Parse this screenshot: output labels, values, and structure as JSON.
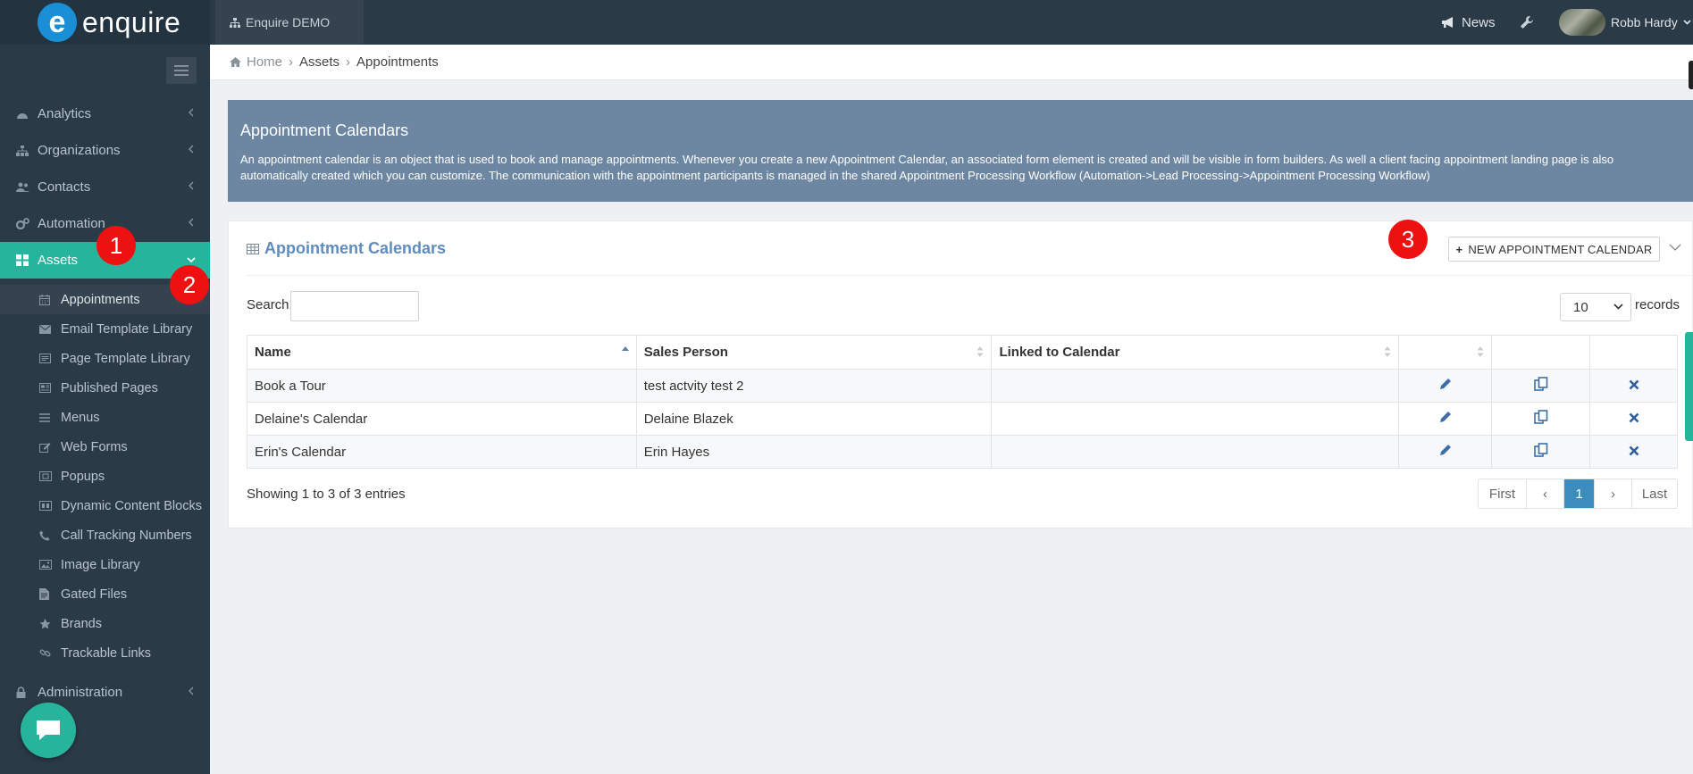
{
  "app": {
    "logo_letter": "e",
    "logo_text": "enquire",
    "account": "Enquire DEMO"
  },
  "header": {
    "news_label": "News",
    "user_name": "Robb Hardy"
  },
  "sidebar": {
    "items": [
      {
        "label": "Analytics",
        "icon": "dashboard-icon"
      },
      {
        "label": "Organizations",
        "icon": "sitemap-icon"
      },
      {
        "label": "Contacts",
        "icon": "users-icon"
      },
      {
        "label": "Automation",
        "icon": "cogs-icon"
      },
      {
        "label": "Assets",
        "icon": "grid-icon",
        "active": true
      },
      {
        "label": "Administration",
        "icon": "lock-icon"
      }
    ],
    "sub_items": [
      {
        "label": "Appointments",
        "icon": "calendar-icon",
        "current": true
      },
      {
        "label": "Email Template Library",
        "icon": "envelope-icon"
      },
      {
        "label": "Page Template Library",
        "icon": "page-template-icon"
      },
      {
        "label": "Published Pages",
        "icon": "published-page-icon"
      },
      {
        "label": "Menus",
        "icon": "menu-lines-icon"
      },
      {
        "label": "Web Forms",
        "icon": "edit-icon"
      },
      {
        "label": "Popups",
        "icon": "popup-icon"
      },
      {
        "label": "Dynamic Content Blocks",
        "icon": "blocks-icon"
      },
      {
        "label": "Call Tracking Numbers",
        "icon": "phone-icon"
      },
      {
        "label": "Image Library",
        "icon": "image-icon"
      },
      {
        "label": "Gated Files",
        "icon": "file-icon"
      },
      {
        "label": "Brands",
        "icon": "star-icon"
      },
      {
        "label": "Trackable Links",
        "icon": "link-icon"
      }
    ]
  },
  "markers": [
    "1",
    "2",
    "3"
  ],
  "breadcrumb": [
    "Home",
    "Assets",
    "Appointments"
  ],
  "banner": {
    "title": "Appointment Calendars",
    "text": "An appointment calendar is an object that is used to book and manage appointments. Whenever you create a new Appointment Calendar, an associated form element is created and will be visible in form builders. As well a client facing appointment landing page is also automatically created which you can customize. The communication with the appointment participants is managed in the shared Appointment Processing Workflow (Automation->Lead Processing->Appointment Processing Workflow)"
  },
  "panel": {
    "title": "Appointment Calendars",
    "new_button": "NEW APPOINTMENT CALENDAR",
    "search_label": "Search:",
    "search_value": "",
    "records_value": "10",
    "records_label": "records",
    "columns": [
      "Name",
      "Sales Person",
      "Linked to Calendar",
      "",
      "",
      ""
    ],
    "rows": [
      {
        "name": "Book a Tour",
        "sales_person": "test actvity test 2",
        "linked": ""
      },
      {
        "name": "Delaine's Calendar",
        "sales_person": "Delaine Blazek",
        "linked": ""
      },
      {
        "name": "Erin's Calendar",
        "sales_person": "Erin Hayes",
        "linked": ""
      }
    ],
    "info": "Showing 1 to 3 of 3 entries",
    "pager": {
      "first": "First",
      "prev": "‹",
      "current": "1",
      "next": "›",
      "last": "Last"
    }
  },
  "colors": {
    "accent": "#26b59c",
    "sidebar_bg": "#2b3a47",
    "banner_bg": "#6d87a3",
    "link_blue": "#3c8dbc",
    "marker_red": "#ee1111"
  }
}
